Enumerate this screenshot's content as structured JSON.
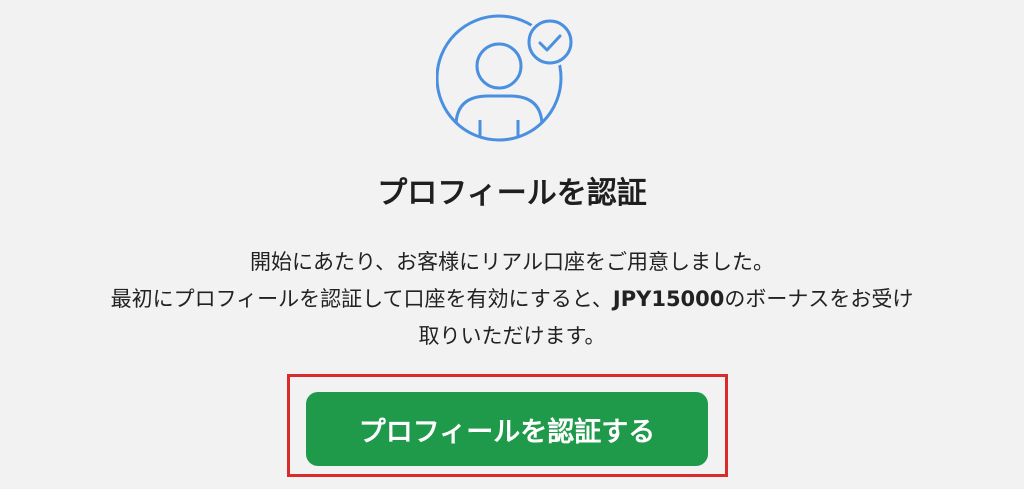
{
  "icon": {
    "name": "verified-user-icon",
    "color": "#4a8fe0"
  },
  "title": "プロフィールを認証",
  "description": {
    "line1": "開始にあたり、お客様にリアル口座をご用意しました。",
    "line2_pre": "最初にプロフィールを認証して口座を有効にすると、",
    "line2_bonus": "JPY15000",
    "line2_post": "のボーナスをお受け",
    "line3": "取りいただけます。"
  },
  "cta": {
    "label": "プロフィールを認証する",
    "background": "#1f9a4a",
    "highlight_color": "#d92b2b"
  }
}
